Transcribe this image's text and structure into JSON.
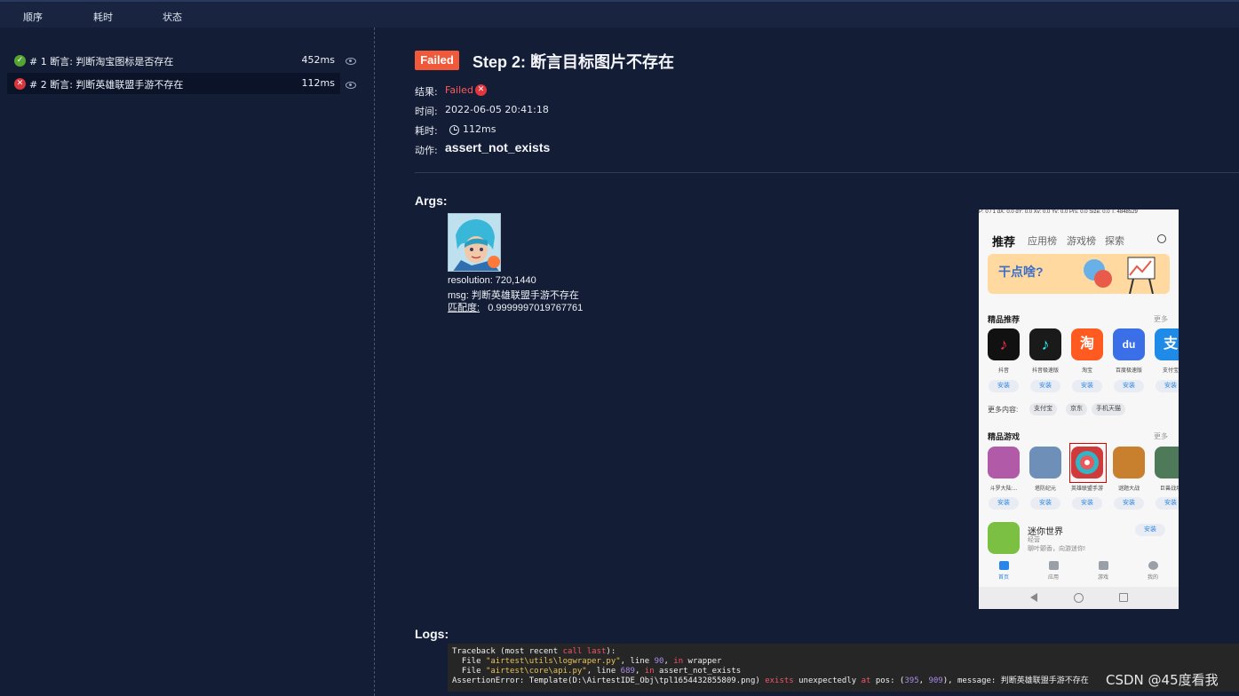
{
  "header": {
    "col_order": "顺序",
    "col_time": "耗时",
    "col_status": "状态"
  },
  "steps": [
    {
      "label": "# 1 断言:  判断淘宝图标是否存在",
      "time": "452ms",
      "status": "passed"
    },
    {
      "label": "# 2 断言:  判断英雄联盟手游不存在",
      "time": "112ms",
      "status": "failed"
    }
  ],
  "detail": {
    "badge": "Failed",
    "title": "Step 2: 断言目标图片不存在",
    "result_label": "结果:",
    "result_value": "Failed",
    "time_label": "时间:",
    "time_value": "2022-06-05 20:41:18",
    "duration_label": "耗时:",
    "duration_value": "112ms",
    "action_label": "动作:",
    "action_value": "assert_not_exists",
    "args_title": "Args:",
    "args": {
      "resolution": "resolution: 720,1440",
      "msg": "msg: 判断英雄联盟手游不存在",
      "match_key": "匹配度:",
      "match_value": "0.9999997019767761"
    },
    "logs_title": "Logs:"
  },
  "phone": {
    "status_text": "P: 0 / 1    dX: 0.0    dY: 0.0    Xv: 0.0    Yv: 0.0    Prs: 0.0    Size: 0.0    T: 4848529",
    "nav": [
      "推荐",
      "应用榜",
      "游戏榜",
      "探索"
    ],
    "banner_text": "干点啥?",
    "sec_apps": "精品推荐",
    "more": "更多",
    "apps": [
      {
        "name": "抖音",
        "color": "#111111",
        "glyph": "♪"
      },
      {
        "name": "抖音极速版",
        "color": "#1a1a1a",
        "glyph": "♪"
      },
      {
        "name": "淘宝",
        "color": "#ff5a1f",
        "glyph": "淘"
      },
      {
        "name": "百度极速版",
        "color": "#3a6fe8",
        "glyph": "du"
      },
      {
        "name": "支付宝",
        "color": "#1f8be8",
        "glyph": "支"
      }
    ],
    "install": "安装",
    "more_content_label": "更多内容:",
    "chips": [
      "支付宝",
      "京东",
      "手机天猫"
    ],
    "sec_games": "精品游戏",
    "games": [
      {
        "name": "斗罗大陆:...",
        "color": "#b05aa8"
      },
      {
        "name": "塔防纪元",
        "color": "#6e8fb8"
      },
      {
        "name": "英雄联盟手游",
        "color": "#d13a3a"
      },
      {
        "name": "谜题大战",
        "color": "#c8802e"
      },
      {
        "name": "巨兽战场",
        "color": "#4f7a5a"
      }
    ],
    "featured_title": "迷你世界",
    "featured_sub1": "经营",
    "featured_sub2": "聊叶颤香，向游迷你!",
    "tabs": [
      "首页",
      "应用",
      "游戏",
      "我的"
    ]
  },
  "log": {
    "line1": "Traceback (most recent call last):",
    "line2_file": "\"airtest\\utils\\logwraper.py\"",
    "line2_line": "90",
    "line2_func": "wrapper",
    "line3_file": "\"airtest\\core\\api.py\"",
    "line3_line": "689",
    "line3_func": "assert_not_exists",
    "line4_template": "AssertionError: Template(D:\\AirtestIDE_Obj\\tpl1654432855809.png)",
    "pos_x": "395",
    "pos_y": "909",
    "message": "判断英雄联盟手游不存在"
  },
  "watermark": "CSDN @45度看我",
  "colors": {
    "background": "#131d35",
    "failed": "#f05a3a",
    "passed": "#55a532"
  }
}
